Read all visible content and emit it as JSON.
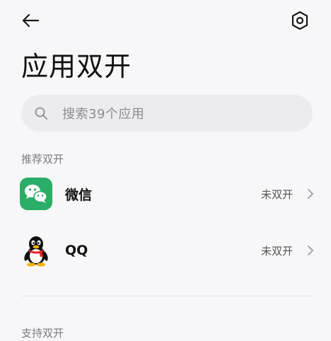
{
  "header": {
    "back_icon": "arrow-left-icon",
    "settings_icon": "gear-icon"
  },
  "page": {
    "title": "应用双开"
  },
  "search": {
    "placeholder": "搜索39个应用"
  },
  "recommended": {
    "label": "推荐双开",
    "apps": [
      {
        "name": "微信",
        "status": "未双开",
        "icon": "wechat-icon",
        "color": "#2aae67"
      },
      {
        "name": "QQ",
        "status": "未双开",
        "icon": "qq-penguin-icon",
        "color": "#111111"
      }
    ]
  },
  "supported": {
    "label": "支持双开"
  },
  "colors": {
    "background": "#f7f7f9",
    "search_bg": "#ececf0",
    "accent_green": "#2aae67"
  }
}
